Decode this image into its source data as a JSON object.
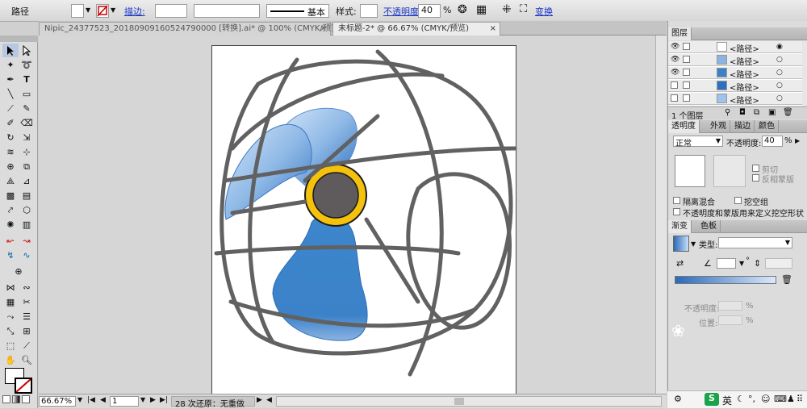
{
  "control_bar": {
    "object_type": "路径",
    "stroke_label": "描边:",
    "stroke_profile": "基本",
    "style_label": "样式:",
    "opacity_label": "不透明度",
    "opacity_value": "40",
    "opacity_unit": "%",
    "transform_label": "变换"
  },
  "tabs": [
    {
      "label": "Nipic_24377523_20180909160524790000 [转换].ai* @ 100% (CMYK/预览)",
      "close": "×"
    },
    {
      "label": "未标题-2* @ 66.67% (CMYK/预览)",
      "close": "×"
    }
  ],
  "status": {
    "zoom": "66.67%",
    "page": "1",
    "undo_text": "28 次还原：无重做"
  },
  "layers_panel": {
    "title": "图层",
    "rows": [
      "<路径>",
      "<路径>",
      "<路径>",
      "<路径>",
      "<路径>"
    ],
    "footer": "1 个图层"
  },
  "transparency_panel": {
    "tabs": [
      "透明度",
      "外观",
      "描边",
      "颜色"
    ],
    "blend_mode": "正常",
    "opacity_label": "不透明度:",
    "opacity_value": "40",
    "opacity_unit": "%",
    "clip_label": "剪切",
    "invert_mask_label": "反相蒙版",
    "isolate_label": "隔离混合",
    "knockout_label": "挖空组",
    "define_knockout_label": "不透明度和蒙版用来定义挖空形状"
  },
  "gradient_panel": {
    "tabs": [
      "渐变",
      "色板"
    ],
    "type_label": "类型:",
    "opacity_label": "不透明度:",
    "location_label": "位置:",
    "percent": "%"
  },
  "taskbar": {
    "ime": "英"
  },
  "colors": {
    "fan_blade": "#3a82c8",
    "fan_blade_light": "#bcd7f2",
    "hub_ring": "#f4c20d",
    "hub_center": "#5f5a5b",
    "cage": "#616161"
  }
}
